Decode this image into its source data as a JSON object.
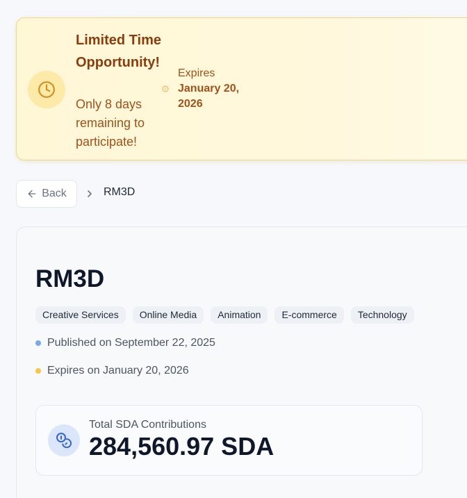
{
  "banner": {
    "title": "Limited Time Opportunity!",
    "subtitle": "Only 8 days remaining to participate!",
    "expires_label": "Expires",
    "expires_date": "January 20, 2026"
  },
  "nav": {
    "back_label": "Back",
    "breadcrumb_current": "RM3D"
  },
  "project": {
    "title": "RM3D",
    "tags": [
      "Creative Services",
      "Online Media",
      "Animation",
      "E-commerce",
      "Technology"
    ],
    "published": "Published on September 22, 2025",
    "expires": "Expires on January 20, 2026"
  },
  "stats": {
    "label": "Total SDA Contributions",
    "value": "284,560.97 SDA"
  },
  "colors": {
    "accent_amber": "#d4901f",
    "published_dot": "#7ba7f0",
    "expires_dot": "#f5c74a",
    "stat_icon": "#3563d8"
  },
  "icons": {
    "banner": "clock-icon",
    "info": "info-icon",
    "back": "arrow-left-icon",
    "separator": "chevron-right-icon",
    "stat": "coins-icon"
  }
}
